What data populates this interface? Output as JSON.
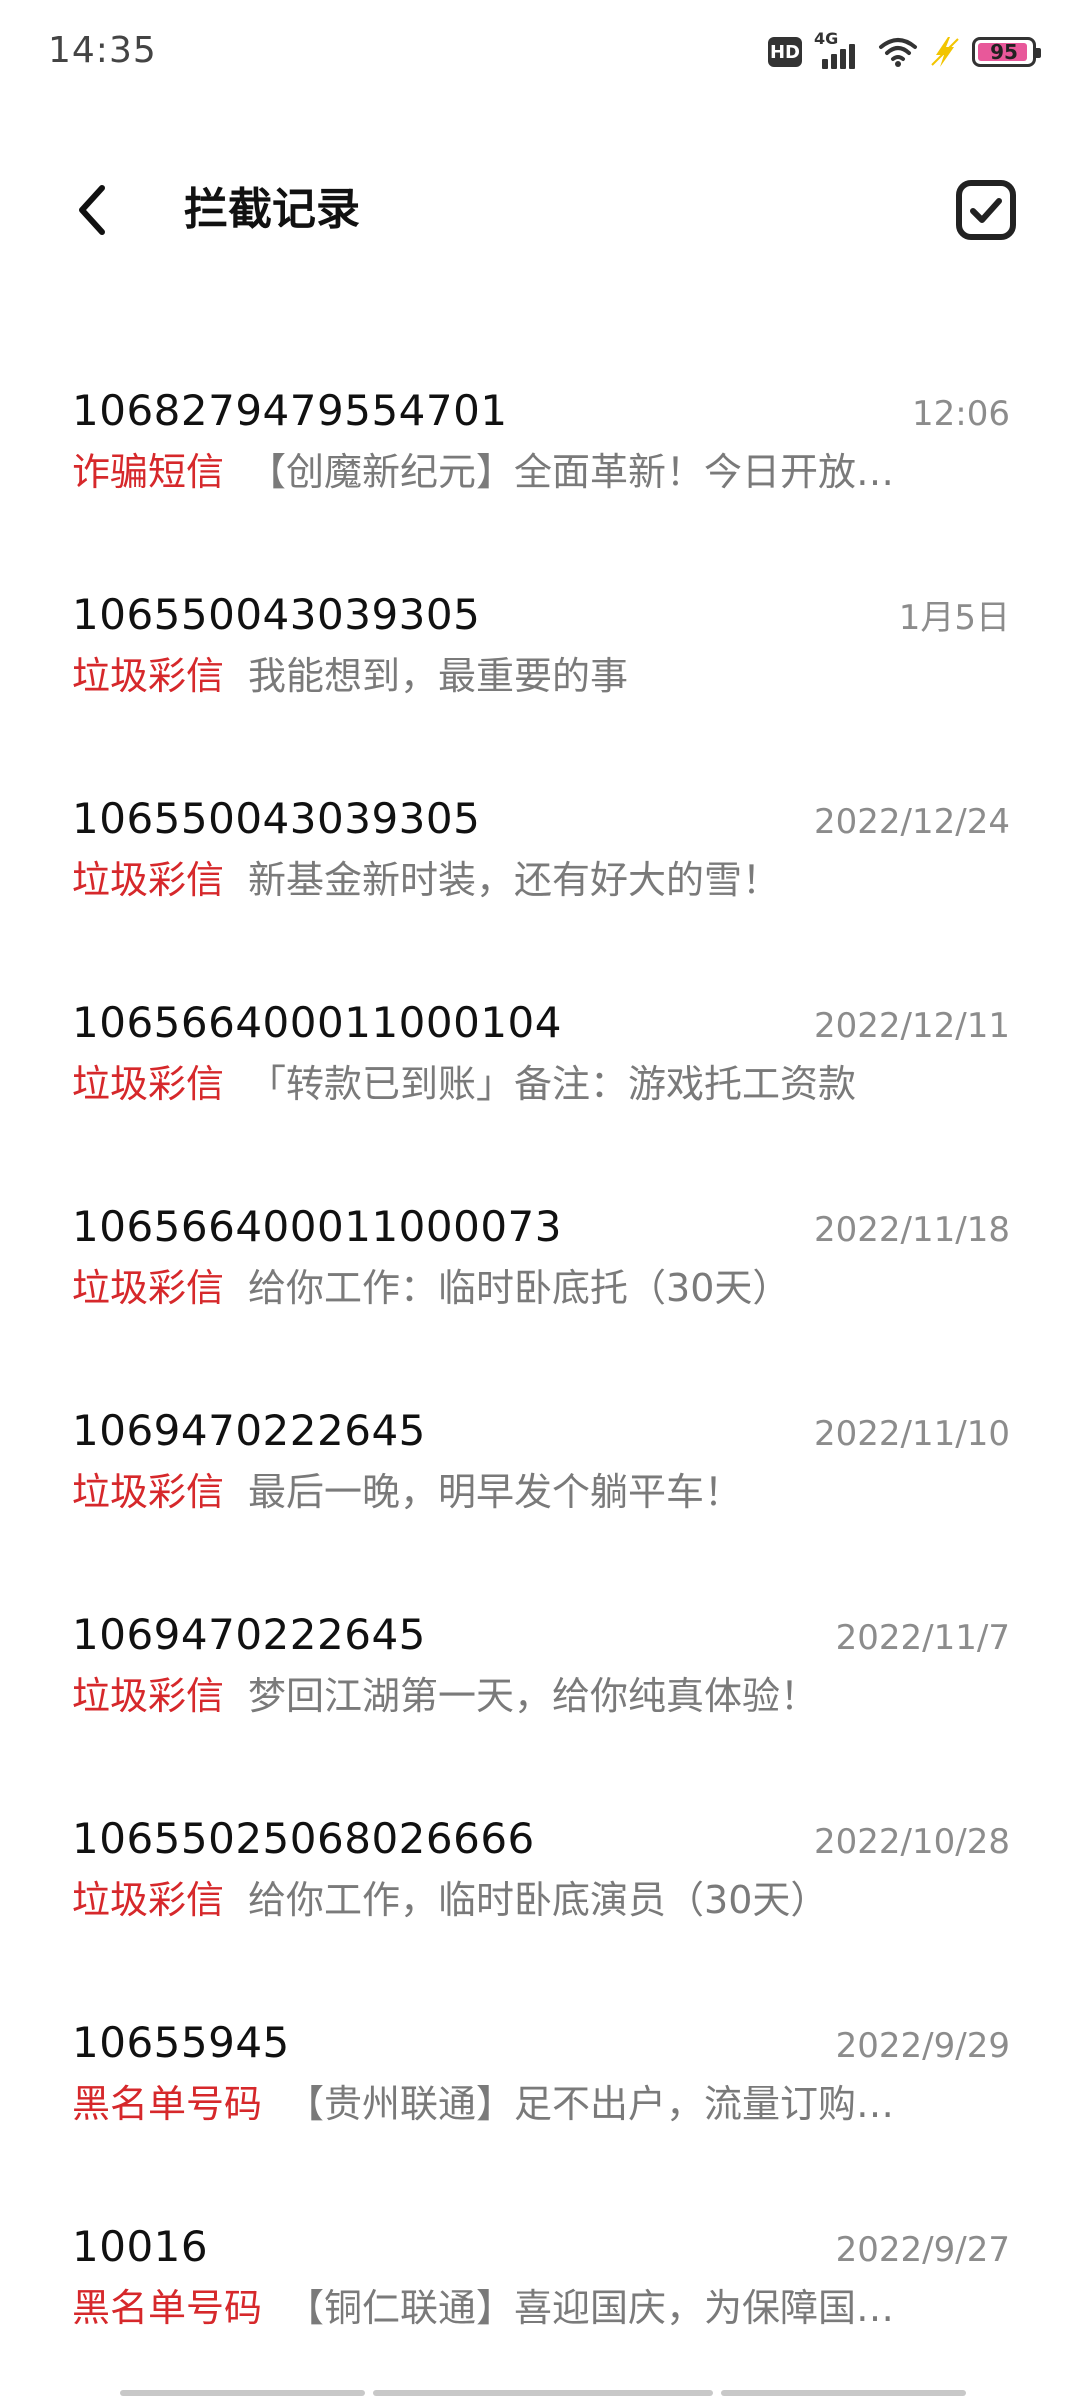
{
  "status_bar": {
    "time": "14:35",
    "hd_label": "HD",
    "network_label": "4G",
    "battery_level": "95",
    "battery_color": "#e8589a"
  },
  "header": {
    "title": "拦截记录",
    "back_icon": "chevron-left-icon",
    "select_icon": "checkbox-checked-icon"
  },
  "theme": {
    "accent": "#d6282b",
    "secondary_text": "#7a7a7a"
  },
  "messages": [
    {
      "sender": "1068279479554701",
      "date": "12:06",
      "category": "诈骗短信",
      "preview": "【创魔新纪元】全面革新！今日开放…"
    },
    {
      "sender": "106550043039305",
      "date": "1月5日",
      "category": "垃圾彩信",
      "preview": "我能想到，最重要的事"
    },
    {
      "sender": "106550043039305",
      "date": "2022/12/24",
      "category": "垃圾彩信",
      "preview": "新基金新时装，还有好大的雪！"
    },
    {
      "sender": "106566400011000104",
      "date": "2022/12/11",
      "category": "垃圾彩信",
      "preview": "「转款已到账」备注：游戏托工资款"
    },
    {
      "sender": "106566400011000073",
      "date": "2022/11/18",
      "category": "垃圾彩信",
      "preview": "给你工作：临时卧底托（30天）"
    },
    {
      "sender": "1069470222645",
      "date": "2022/11/10",
      "category": "垃圾彩信",
      "preview": "最后一晚，明早发个躺平车！"
    },
    {
      "sender": "1069470222645",
      "date": "2022/11/7",
      "category": "垃圾彩信",
      "preview": "梦回江湖第一天，给你纯真体验！"
    },
    {
      "sender": "10655025068026666",
      "date": "2022/10/28",
      "category": "垃圾彩信",
      "preview": "给你工作，临时卧底演员（30天）"
    },
    {
      "sender": "10655945",
      "date": "2022/9/29",
      "category": "黑名单号码",
      "preview": "【贵州联通】足不出户，流量订购…"
    },
    {
      "sender": "10016",
      "date": "2022/9/27",
      "category": "黑名单号码",
      "preview": "【铜仁联通】喜迎国庆，为保障国…"
    }
  ]
}
